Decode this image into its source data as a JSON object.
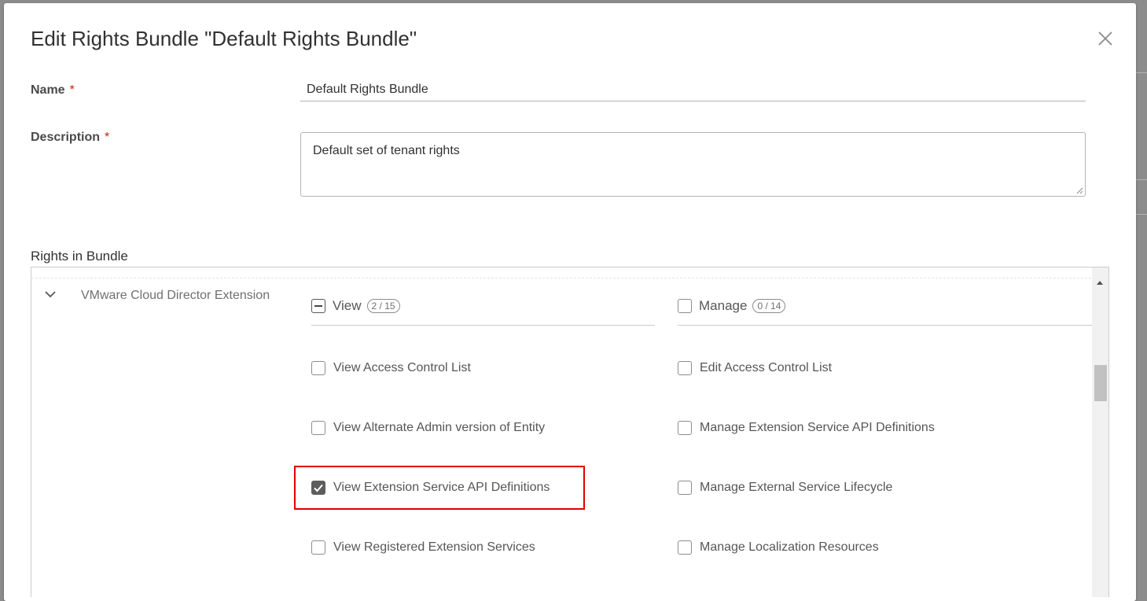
{
  "dialog": {
    "title": "Edit Rights Bundle \"Default Rights Bundle\"",
    "close_icon": "close-icon"
  },
  "form": {
    "name_label": "Name",
    "description_label": "Description",
    "required_marker": "*",
    "name_value": "Default Rights Bundle",
    "description_value": "Default set of tenant rights"
  },
  "rights": {
    "section_label": "Rights in Bundle",
    "group": {
      "name": "VMware Cloud Director Extension",
      "expanded": true,
      "view": {
        "label": "View",
        "count": "2 / 15",
        "state": "indeterminate",
        "items": [
          {
            "label": "View Access Control List",
            "checked": false
          },
          {
            "label": "View Alternate Admin version of Entity",
            "checked": false
          },
          {
            "label": "View Extension Service API Definitions",
            "checked": true
          },
          {
            "label": "View Registered Extension Services",
            "checked": false
          }
        ]
      },
      "manage": {
        "label": "Manage",
        "count": "0 / 14",
        "state": "unchecked",
        "items": [
          {
            "label": "Edit Access Control List",
            "checked": false
          },
          {
            "label": "Manage Extension Service API Definitions",
            "checked": false
          },
          {
            "label": "Manage External Service Lifecycle",
            "checked": false
          },
          {
            "label": "Manage Localization Resources",
            "checked": false
          }
        ]
      }
    }
  },
  "colors": {
    "highlight_box": "#e00000",
    "required_marker": "#c92100",
    "checked_fill": "#5d5d5d"
  }
}
